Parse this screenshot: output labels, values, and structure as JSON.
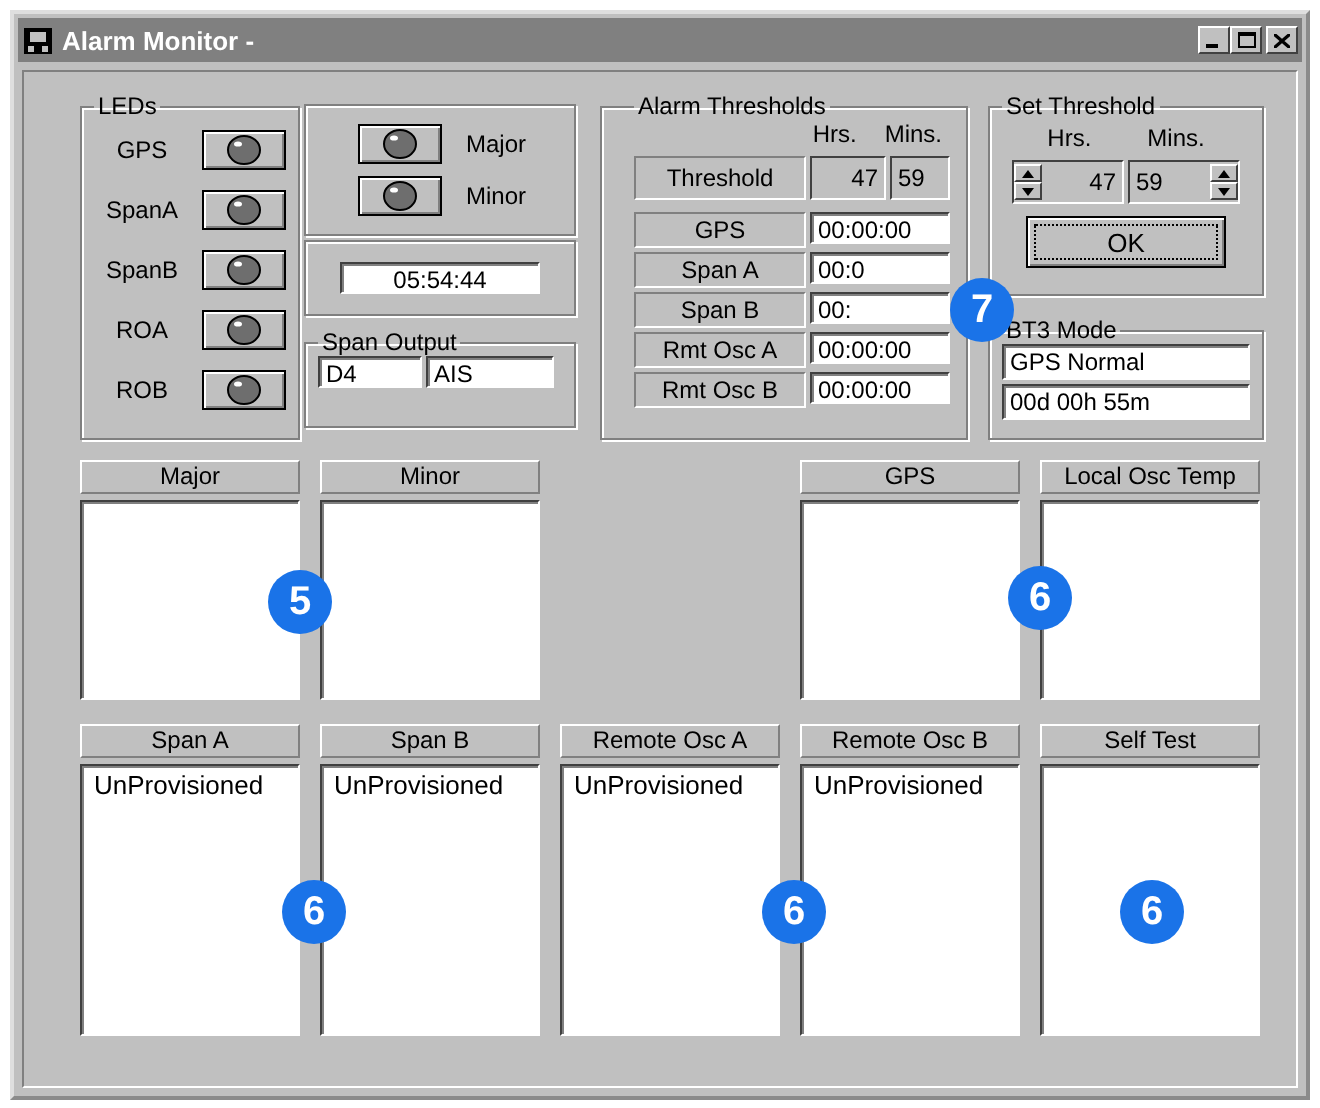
{
  "window": {
    "title": "Alarm Monitor -"
  },
  "leds": {
    "title": "LEDs",
    "items": [
      {
        "label": "GPS"
      },
      {
        "label": "SpanA"
      },
      {
        "label": "SpanB"
      },
      {
        "label": "ROA"
      },
      {
        "label": "ROB"
      }
    ]
  },
  "alarm_leds": [
    {
      "label": "Major"
    },
    {
      "label": "Minor"
    }
  ],
  "clock": "05:54:44",
  "span_output": {
    "title": "Span Output",
    "values": [
      "D4",
      "AIS"
    ]
  },
  "alarm_thresholds": {
    "title": "Alarm Thresholds",
    "headers": [
      "Hrs.",
      "Mins."
    ],
    "threshold": {
      "label": "Threshold",
      "hours": "47",
      "mins": "59"
    },
    "rows": [
      {
        "label": "GPS",
        "value": "00:00:00"
      },
      {
        "label": "Span A",
        "value": "00:0"
      },
      {
        "label": "Span B",
        "value": "00:"
      },
      {
        "label": "Rmt Osc A",
        "value": "00:00:00"
      },
      {
        "label": "Rmt Osc B",
        "value": "00:00:00"
      }
    ]
  },
  "set_threshold": {
    "title": "Set Threshold",
    "headers": [
      "Hrs.",
      "Mins."
    ],
    "hours": "47",
    "mins": "59",
    "button": "OK"
  },
  "bt3_mode": {
    "title": "BT3 Mode",
    "values": [
      "GPS Normal",
      "00d 00h 55m"
    ]
  },
  "panel_rows": [
    [
      {
        "kind": "list",
        "title": "Major"
      },
      {
        "kind": "list",
        "title": "Minor"
      },
      {
        "kind": "gap"
      },
      {
        "kind": "list",
        "title": "GPS"
      },
      {
        "kind": "list",
        "title": "Local Osc Temp"
      }
    ],
    [
      {
        "kind": "list",
        "title": "Span A",
        "items": [
          "UnProvisioned"
        ]
      },
      {
        "kind": "list",
        "title": "Span B",
        "items": [
          "UnProvisioned"
        ]
      },
      {
        "kind": "list",
        "title": "Remote Osc A",
        "items": [
          "UnProvisioned"
        ]
      },
      {
        "kind": "list",
        "title": "Remote Osc B",
        "items": [
          "UnProvisioned"
        ]
      },
      {
        "kind": "list",
        "title": "Self Test"
      }
    ]
  ],
  "callouts": [
    {
      "label": "7"
    },
    {
      "label": "5"
    },
    {
      "label": "6"
    },
    {
      "label": "6"
    },
    {
      "label": "6"
    },
    {
      "label": "6"
    }
  ]
}
